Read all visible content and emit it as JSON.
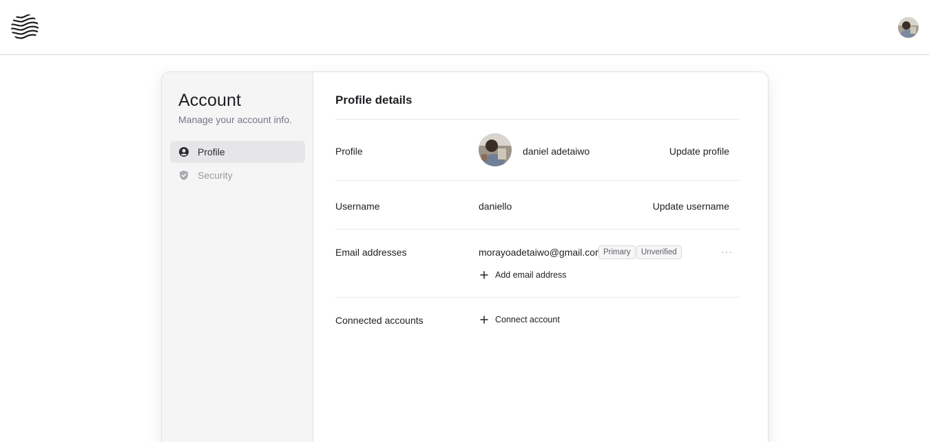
{
  "header": {
    "logo_icon": "wave-logo-icon",
    "avatar_icon": "user-avatar-photo"
  },
  "sidebar": {
    "title": "Account",
    "subtitle": "Manage your account info.",
    "items": [
      {
        "label": "Profile",
        "icon": "user-circle-icon",
        "active": true
      },
      {
        "label": "Security",
        "icon": "shield-check-icon",
        "active": false
      }
    ]
  },
  "main": {
    "title": "Profile details",
    "profile": {
      "label": "Profile",
      "name": "daniel adetaiwo",
      "action": "Update profile"
    },
    "username": {
      "label": "Username",
      "value": "daniello",
      "action": "Update username"
    },
    "emails": {
      "label": "Email addresses",
      "address": "morayoadetaiwo@gmail.com",
      "badges": [
        "Primary",
        "Unverified"
      ],
      "more": "···",
      "add": "Add email address"
    },
    "connected": {
      "label": "Connected accounts",
      "add": "Connect account"
    }
  },
  "colors": {
    "sidebar_bg": "#f5f5f5",
    "active_item_bg": "#e6e6e8",
    "text": "#212126",
    "muted": "#747686"
  }
}
